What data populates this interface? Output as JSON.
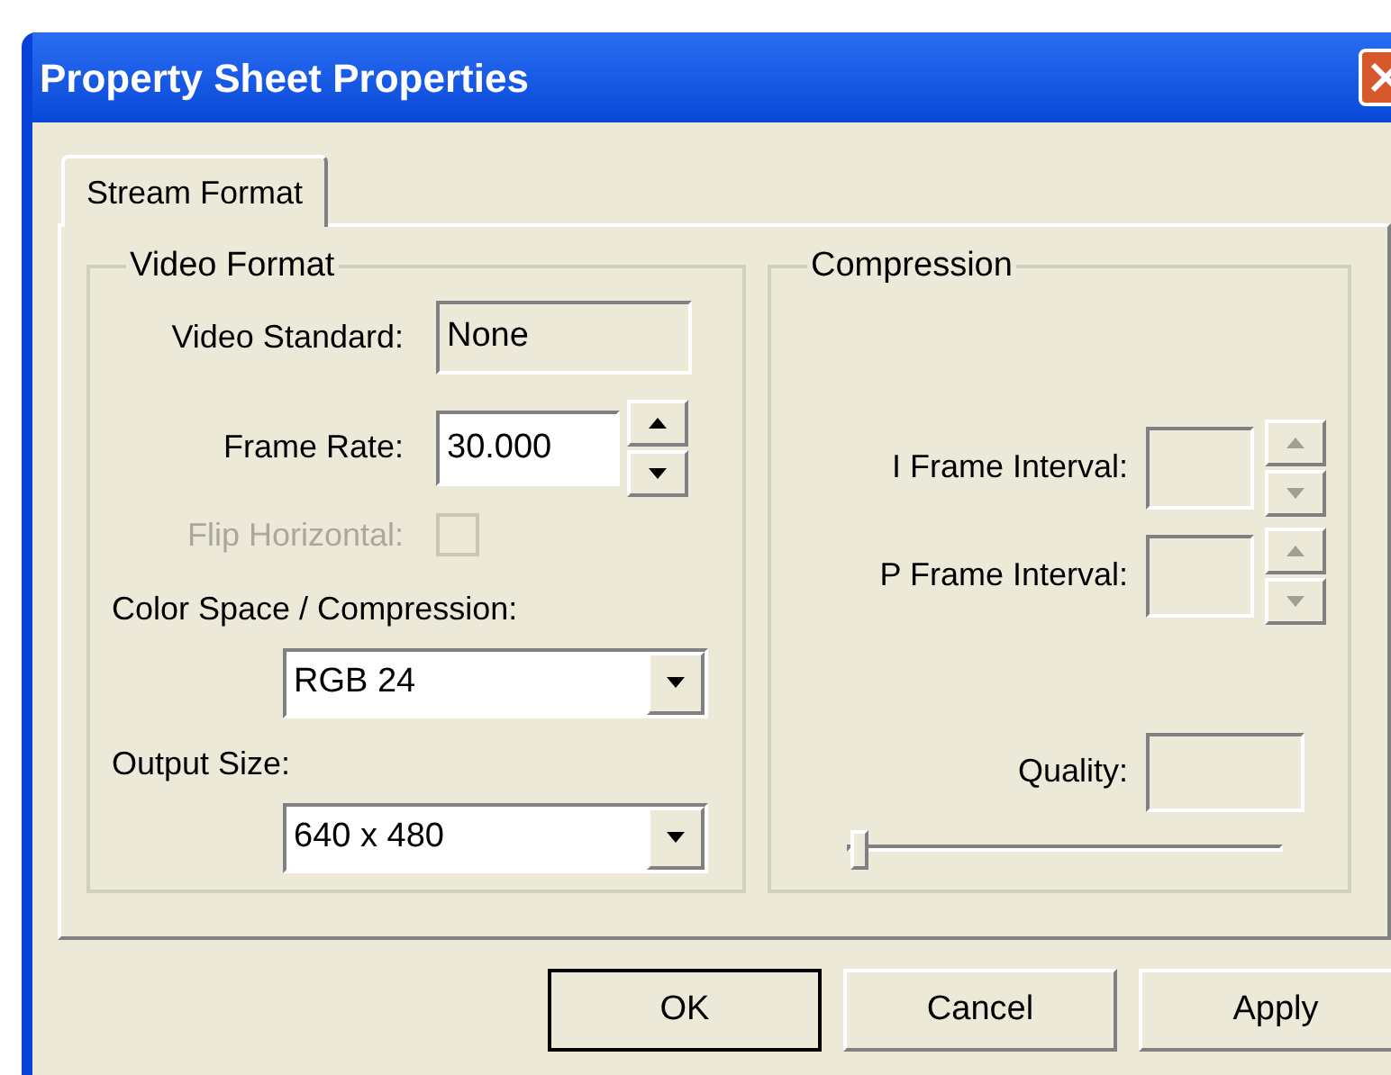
{
  "window": {
    "title": "Property Sheet Properties"
  },
  "tabs": [
    {
      "label": "Stream Format",
      "selected": true
    }
  ],
  "video_format": {
    "title": "Video Format",
    "video_standard": {
      "label": "Video Standard:",
      "value": "None"
    },
    "frame_rate": {
      "label": "Frame Rate:",
      "value": "30.000"
    },
    "flip_horizontal": {
      "label": "Flip Horizontal:",
      "disabled": true,
      "checked": false
    },
    "color_space": {
      "label": "Color Space / Compression:",
      "value": "RGB 24"
    },
    "output_size": {
      "label": "Output Size:",
      "value": "640 x 480"
    }
  },
  "compression": {
    "title": "Compression",
    "intervals": [
      {
        "label": "I Frame Interval:",
        "disabled": true
      },
      {
        "label": "P Frame Interval:",
        "disabled": true
      }
    ],
    "quality": {
      "label": "Quality:",
      "disabled": true,
      "level": 0
    }
  },
  "buttons": [
    {
      "label": "OK",
      "default": true
    },
    {
      "label": "Cancel",
      "default": false
    },
    {
      "label": "Apply",
      "default": false
    }
  ]
}
